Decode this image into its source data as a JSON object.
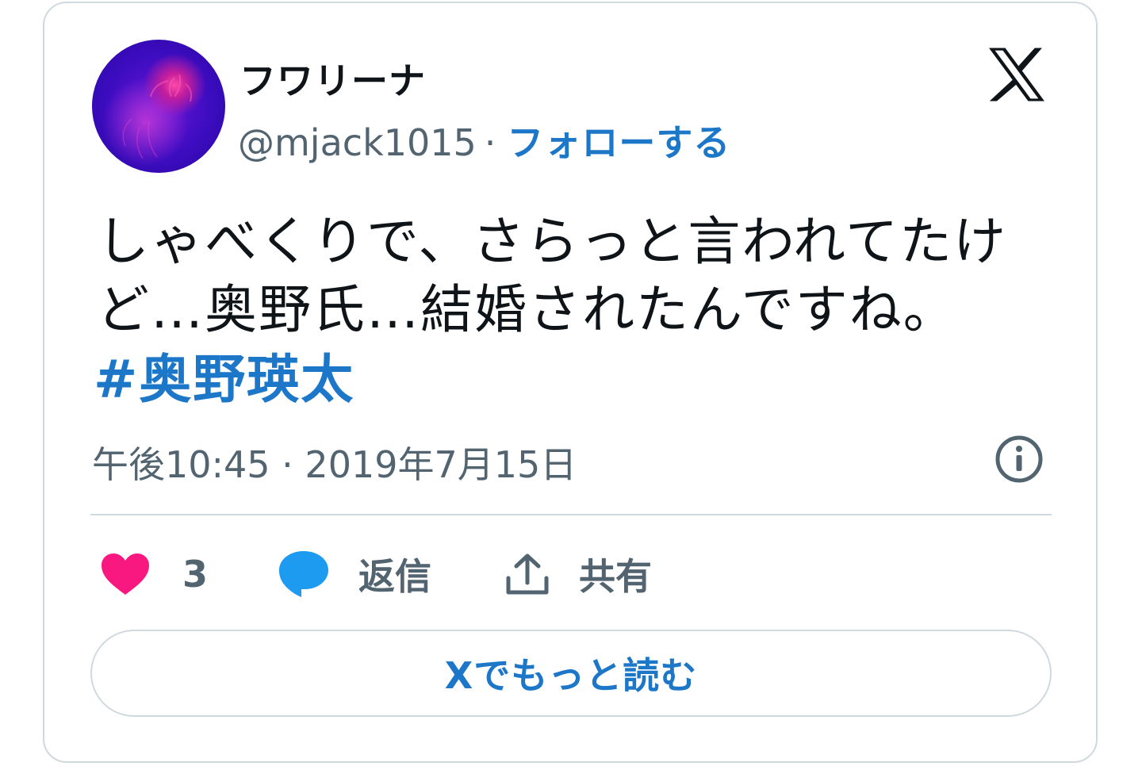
{
  "author": {
    "display_name": "フワリーナ",
    "handle": "@mjack1015",
    "separator": "·",
    "follow_label": "フォローする"
  },
  "tweet": {
    "text_line1": "しゃべくりで、さらっと言われてたけ",
    "text_line2": "ど…奥野氏…結婚されたんですね。",
    "hashtag": "#奥野瑛太",
    "timestamp": "午後10:45 · 2019年7月15日"
  },
  "actions": {
    "like_count": "3",
    "reply_label": "返信",
    "share_label": "共有"
  },
  "read_more_label": "Xでもっと読む",
  "colors": {
    "link": "#1d77c9",
    "secondary_text": "#536471",
    "like": "#f91880",
    "reply": "#1d9bf0",
    "border": "#cfd9de"
  },
  "icons": [
    "x-logo-icon",
    "info-icon",
    "heart-icon",
    "speech-bubble-icon",
    "share-icon"
  ]
}
